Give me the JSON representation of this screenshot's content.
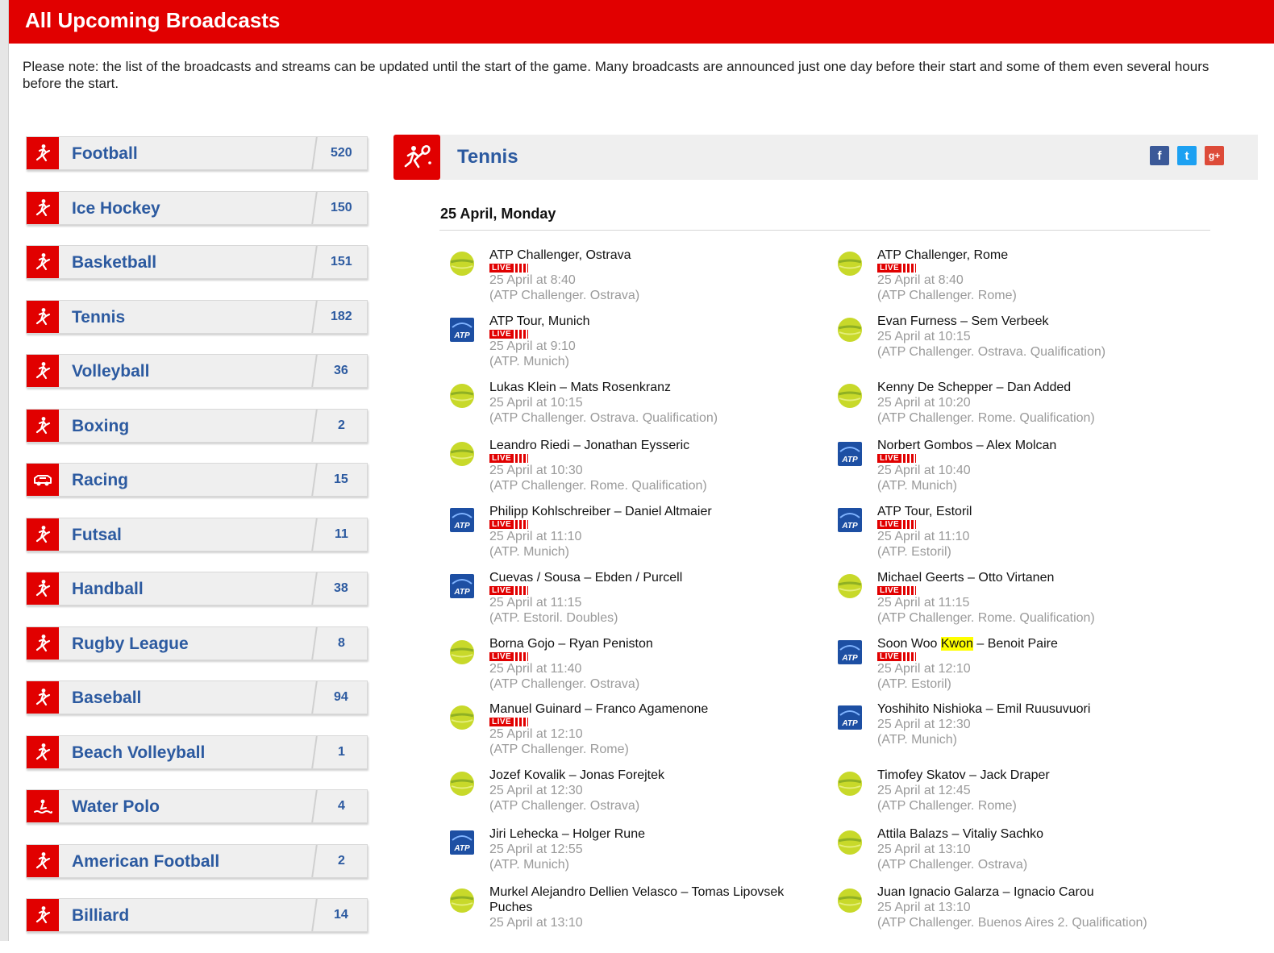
{
  "page": {
    "title": "All Upcoming Broadcasts",
    "notice": "Please note: the list of the broadcasts and streams can be updated until the start of the game. Many broadcasts are announced just one day before their start and some of them even several hours before the start."
  },
  "sports": [
    {
      "label": "Football",
      "count": "520",
      "icon": "football-icon"
    },
    {
      "label": "Ice Hockey",
      "count": "150",
      "icon": "ice-hockey-icon"
    },
    {
      "label": "Basketball",
      "count": "151",
      "icon": "basketball-icon"
    },
    {
      "label": "Tennis",
      "count": "182",
      "icon": "tennis-icon"
    },
    {
      "label": "Volleyball",
      "count": "36",
      "icon": "volleyball-icon"
    },
    {
      "label": "Boxing",
      "count": "2",
      "icon": "boxing-icon"
    },
    {
      "label": "Racing",
      "count": "15",
      "icon": "racing-icon"
    },
    {
      "label": "Futsal",
      "count": "11",
      "icon": "futsal-icon"
    },
    {
      "label": "Handball",
      "count": "38",
      "icon": "handball-icon"
    },
    {
      "label": "Rugby League",
      "count": "8",
      "icon": "rugby-icon"
    },
    {
      "label": "Baseball",
      "count": "94",
      "icon": "baseball-icon"
    },
    {
      "label": "Beach Volleyball",
      "count": "1",
      "icon": "beach-volleyball-icon"
    },
    {
      "label": "Water Polo",
      "count": "4",
      "icon": "water-polo-icon"
    },
    {
      "label": "American Football",
      "count": "2",
      "icon": "american-football-icon"
    },
    {
      "label": "Billiard",
      "count": "14",
      "icon": "billiard-icon"
    }
  ],
  "panel": {
    "title": "Tennis",
    "date": "25 April, Monday",
    "live_label": "LIVE",
    "social": [
      "f",
      "t",
      "g+"
    ]
  },
  "events": {
    "left": [
      {
        "title": "ATP Challenger, Ostrava",
        "live": true,
        "time": "25 April at 8:40",
        "comp": "(ATP Challenger. Ostrava)",
        "logo": "challenger"
      },
      {
        "title": "ATP Tour, Munich",
        "live": true,
        "time": "25 April at 9:10",
        "comp": "(ATP. Munich)",
        "logo": "atp"
      },
      {
        "title": "Lukas Klein – Mats Rosenkranz",
        "live": false,
        "time": "25 April at 10:15",
        "comp": "(ATP Challenger. Ostrava. Qualification)",
        "logo": "challenger"
      },
      {
        "title": "Leandro Riedi – Jonathan Eysseric",
        "live": true,
        "time": "25 April at 10:30",
        "comp": "(ATP Challenger. Rome. Qualification)",
        "logo": "challenger"
      },
      {
        "title": "Philipp Kohlschreiber – Daniel Altmaier",
        "live": true,
        "time": "25 April at 11:10",
        "comp": "(ATP. Munich)",
        "logo": "atp"
      },
      {
        "title": "Cuevas / Sousa – Ebden / Purcell",
        "live": true,
        "time": "25 April at 11:15",
        "comp": "(ATP. Estoril. Doubles)",
        "logo": "atp"
      },
      {
        "title": "Borna Gojo – Ryan Peniston",
        "live": true,
        "time": "25 April at 11:40",
        "comp": "(ATP Challenger. Ostrava)",
        "logo": "challenger"
      },
      {
        "title": "Manuel Guinard – Franco Agamenone",
        "live": true,
        "time": "25 April at 12:10",
        "comp": "(ATP Challenger. Rome)",
        "logo": "challenger"
      },
      {
        "title": "Jozef Kovalik – Jonas Forejtek",
        "live": false,
        "time": "25 April at 12:30",
        "comp": "(ATP Challenger. Ostrava)",
        "logo": "challenger"
      },
      {
        "title": "Jiri Lehecka – Holger Rune",
        "live": false,
        "time": "25 April at 12:55",
        "comp": "(ATP. Munich)",
        "logo": "atp"
      },
      {
        "title": "Murkel Alejandro Dellien Velasco – Tomas Lipovsek Puches",
        "live": false,
        "time": "25 April at 13:10",
        "comp": "",
        "logo": "challenger"
      }
    ],
    "right": [
      {
        "title": "ATP Challenger, Rome",
        "live": true,
        "time": "25 April at 8:40",
        "comp": "(ATP Challenger. Rome)",
        "logo": "challenger"
      },
      {
        "title": "Evan Furness – Sem Verbeek",
        "live": false,
        "time": "25 April at 10:15",
        "comp": "(ATP Challenger. Ostrava. Qualification)",
        "logo": "challenger"
      },
      {
        "title": "Kenny De Schepper – Dan Added",
        "live": false,
        "time": "25 April at 10:20",
        "comp": "(ATP Challenger. Rome. Qualification)",
        "logo": "challenger"
      },
      {
        "title": "Norbert Gombos – Alex Molcan",
        "live": true,
        "time": "25 April at 10:40",
        "comp": "(ATP. Munich)",
        "logo": "atp"
      },
      {
        "title": "ATP Tour, Estoril",
        "live": true,
        "time": "25 April at 11:10",
        "comp": "(ATP. Estoril)",
        "logo": "atp"
      },
      {
        "title": "Michael Geerts – Otto Virtanen",
        "live": true,
        "time": "25 April at 11:15",
        "comp": "(ATP Challenger. Rome. Qualification)",
        "logo": "challenger"
      },
      {
        "title_pre": "Soon Woo ",
        "title_hl": "Kwon",
        "title_post": " – Benoit Paire",
        "live": true,
        "time": "25 April at 12:10",
        "comp": "(ATP. Estoril)",
        "logo": "atp"
      },
      {
        "title": "Yoshihito Nishioka – Emil Ruusuvuori",
        "live": false,
        "time": "25 April at 12:30",
        "comp": "(ATP. Munich)",
        "logo": "atp"
      },
      {
        "title": "Timofey Skatov – Jack Draper",
        "live": false,
        "time": "25 April at 12:45",
        "comp": "(ATP Challenger. Rome)",
        "logo": "challenger"
      },
      {
        "title": "Attila Balazs – Vitaliy Sachko",
        "live": false,
        "time": "25 April at 13:10",
        "comp": "(ATP Challenger. Ostrava)",
        "logo": "challenger"
      },
      {
        "title": "Juan Ignacio Galarza – Ignacio Carou",
        "live": false,
        "time": "25 April at 13:10",
        "comp": "(ATP Challenger. Buenos Aires 2. Qualification)",
        "logo": "challenger"
      }
    ]
  },
  "colors": {
    "brand_red": "#e10000",
    "link_blue": "#2c5aa0",
    "muted": "#9a9a9a"
  }
}
